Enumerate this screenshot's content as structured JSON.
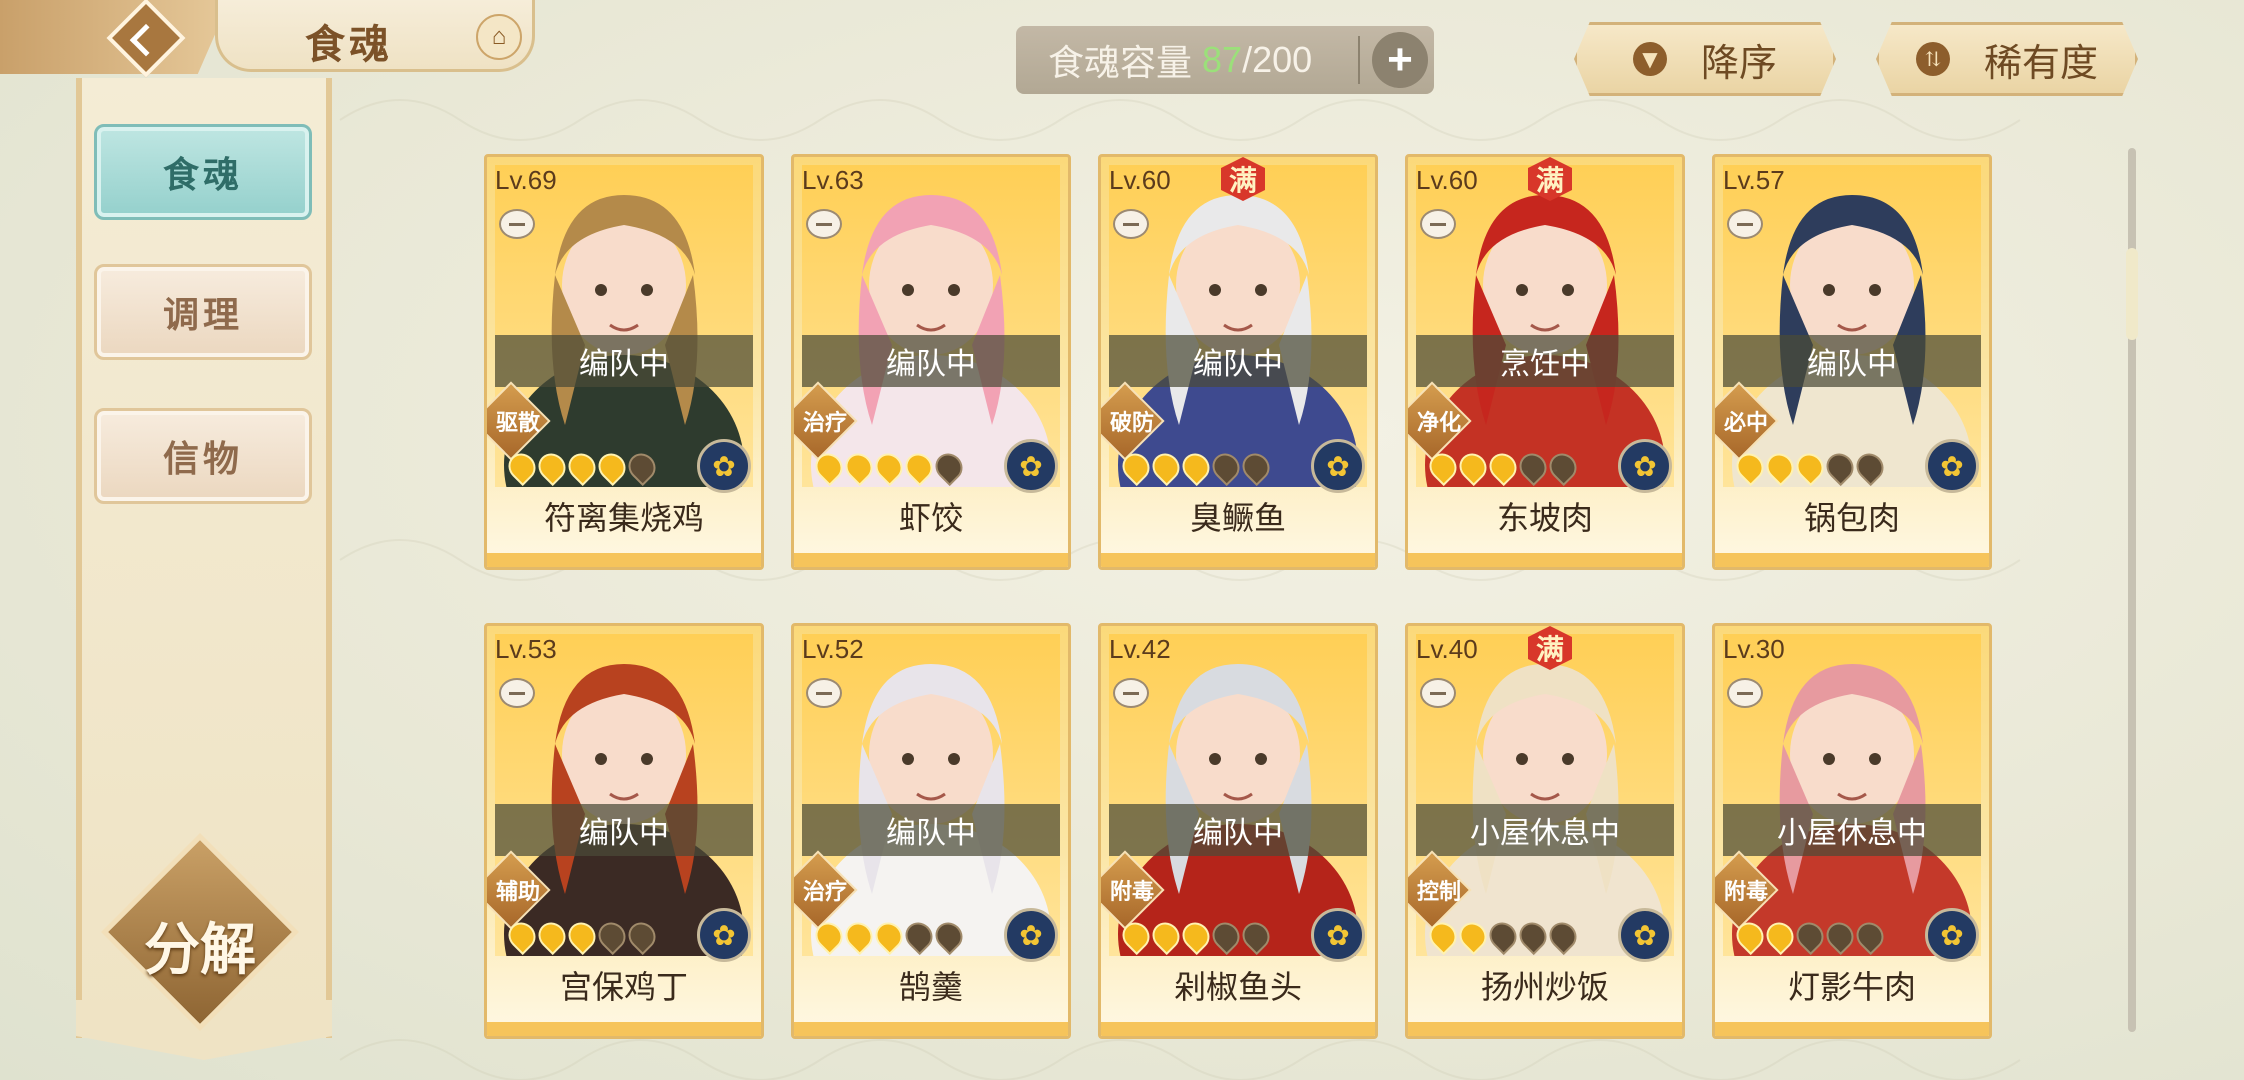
{
  "header": {
    "title": "食魂",
    "back_icon": "back-arrow-icon",
    "home_icon": "pavilion-icon"
  },
  "sidebar": {
    "tabs": [
      {
        "label": "食魂",
        "active": true
      },
      {
        "label": "调理",
        "active": false
      },
      {
        "label": "信物",
        "active": false
      }
    ],
    "decompose_label": "分解"
  },
  "capacity": {
    "label": "食魂容量",
    "current": "87",
    "max": "/200",
    "add_icon": "plus-icon"
  },
  "sort": {
    "order_label": "降序",
    "order_icon": "triangle-down-icon",
    "rarity_label": "稀有度",
    "rarity_icon": "sort-arrows-icon"
  },
  "cards": [
    {
      "level": "Lv.69",
      "status": "编队中",
      "role": "驱散",
      "name": "符离集烧鸡",
      "full": false,
      "stars": 4
    },
    {
      "level": "Lv.63",
      "status": "编队中",
      "role": "治疗",
      "name": "虾饺",
      "full": false,
      "stars": 4
    },
    {
      "level": "Lv.60",
      "status": "编队中",
      "role": "破防",
      "name": "臭鳜鱼",
      "full": true,
      "full_label": "满",
      "stars": 3
    },
    {
      "level": "Lv.60",
      "status": "烹饪中",
      "role": "净化",
      "name": "东坡肉",
      "full": true,
      "full_label": "满",
      "stars": 3
    },
    {
      "level": "Lv.57",
      "status": "编队中",
      "role": "必中",
      "name": "锅包肉",
      "full": false,
      "stars": 3
    },
    {
      "level": "Lv.53",
      "status": "编队中",
      "role": "辅助",
      "name": "宫保鸡丁",
      "full": false,
      "stars": 3
    },
    {
      "level": "Lv.52",
      "status": "编队中",
      "role": "治疗",
      "name": "鹄羹",
      "full": false,
      "stars": 3
    },
    {
      "level": "Lv.42",
      "status": "编队中",
      "role": "附毒",
      "name": "剁椒鱼头",
      "full": false,
      "stars": 3
    },
    {
      "level": "Lv.40",
      "status": "小屋休息中",
      "role": "控制",
      "name": "扬州炒饭",
      "full": true,
      "full_label": "满",
      "stars": 2
    },
    {
      "level": "Lv.30",
      "status": "小屋休息中",
      "role": "附毒",
      "name": "灯影牛肉",
      "full": false,
      "stars": 2
    }
  ],
  "colors": {
    "accent_teal": "#94d0cc",
    "gold": "#f5b91d",
    "capacity_green": "#9be07a"
  }
}
